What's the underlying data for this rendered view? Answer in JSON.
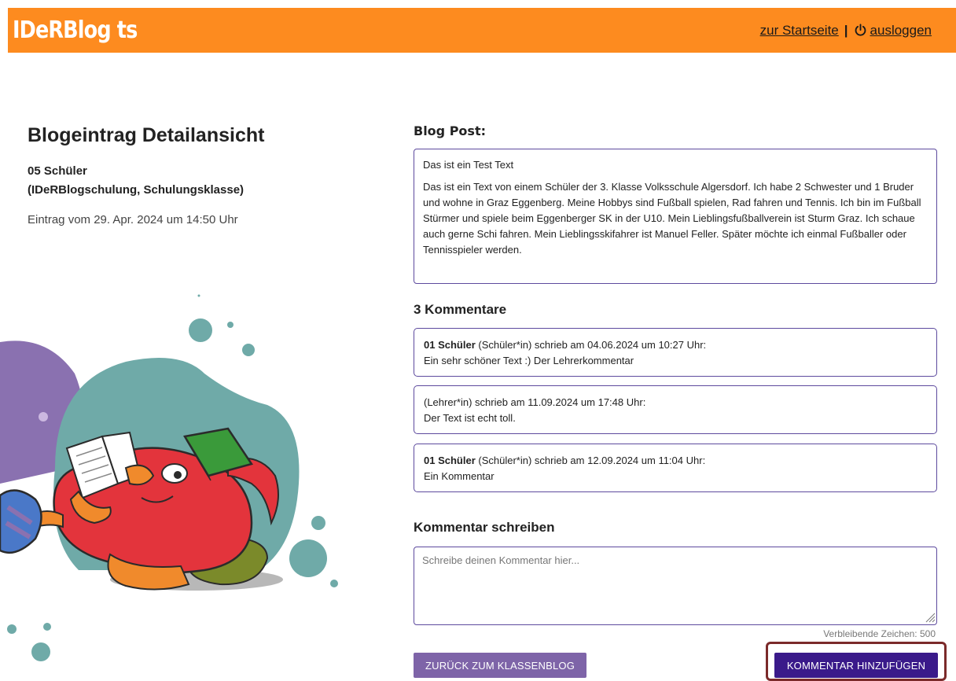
{
  "header": {
    "logo": "IDeRBlog ts",
    "home_link": "zur Startseite",
    "separator": "|",
    "logout_link": "ausloggen"
  },
  "entry": {
    "page_title": "Blogeintrag Detailansicht",
    "author_name": "05 Schüler",
    "author_school": "(IDeRBlogschulung, Schulungsklasse)",
    "date_text": "Eintrag vom 29. Apr. 2024 um 14:50 Uhr"
  },
  "post": {
    "label": "Blog Post:",
    "paragraphs": [
      "Das ist ein Test Text",
      "Das ist ein Text von einem Schüler der 3. Klasse Volksschule Algersdorf. Ich habe 2 Schwester und 1 Bruder und wohne in Graz Eggenberg. Meine Hobbys sind Fußball spielen, Rad fahren und Tennis. Ich bin im Fußball Stürmer und spiele beim Eggenberger SK in der U10. Mein Lieblingsfußballverein ist Sturm Graz. Ich schaue auch gerne Schi fahren. Mein Lieblingsskifahrer ist Manuel Feller. Später möchte ich einmal Fußballer oder Tennisspieler werden."
    ]
  },
  "comments": {
    "label": "3 Kommentare",
    "items": [
      {
        "author": "01 Schüler",
        "meta": " (Schüler*in) schrieb am 04.06.2024 um 10:27 Uhr:",
        "text": "Ein sehr schöner Text :) Der Lehrerkommentar"
      },
      {
        "author": "",
        "meta": "(Lehrer*in) schrieb am 11.09.2024 um 17:48 Uhr:",
        "text": "Der Text ist echt toll."
      },
      {
        "author": "01 Schüler",
        "meta": " (Schüler*in) schrieb am 12.09.2024 um 11:04 Uhr:",
        "text": "Ein Kommentar"
      }
    ]
  },
  "compose": {
    "label": "Kommentar schreiben",
    "placeholder": "Schreibe deinen Kommentar hier...",
    "value": "",
    "char_counter": "Verbleibende Zeichen: 500"
  },
  "buttons": {
    "back": "ZURÜCK ZUM KLASSENBLOG",
    "add": "KOMMENTAR HINZUFÜGEN"
  },
  "colors": {
    "header_bg": "#fd8b1f",
    "accent_border": "#5d4a9e",
    "back_button": "#7e64a8",
    "add_button": "#3a1a8a",
    "highlight_frame": "#7b2a2a"
  },
  "icons": {
    "logout": "power-icon",
    "textarea_resize": "resize-grip-icon"
  }
}
